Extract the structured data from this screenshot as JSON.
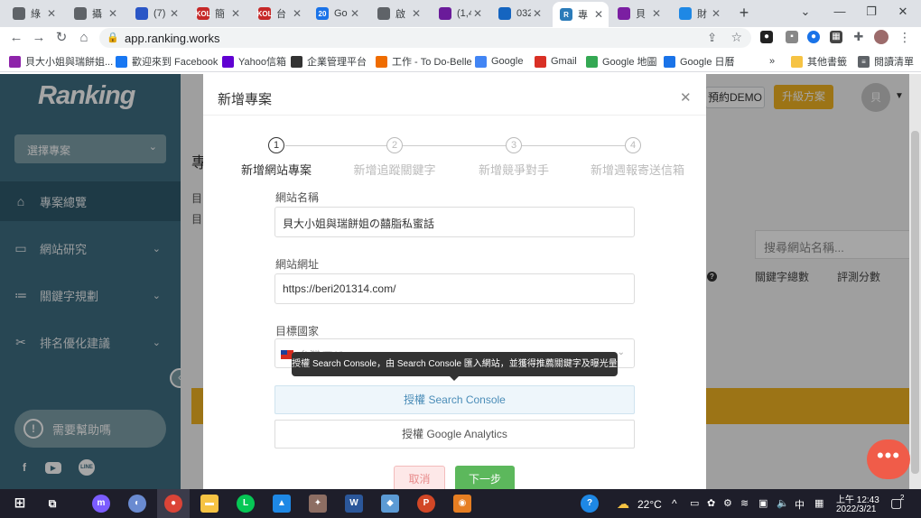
{
  "browser": {
    "tabs": [
      {
        "title": "綠",
        "icon": "globe-icon",
        "color": "#5f6368"
      },
      {
        "title": "攝",
        "icon": "globe-icon",
        "color": "#5f6368"
      },
      {
        "title": "(7)",
        "icon": "chat-icon",
        "color": "#2a56c6"
      },
      {
        "title": "簡",
        "icon": "kol-icon",
        "color": "#c62828",
        "badge": "KOL"
      },
      {
        "title": "台",
        "icon": "kol-icon",
        "color": "#c62828",
        "badge": "KOL"
      },
      {
        "title": "Go",
        "icon": "calendar-icon",
        "color": "#1a73e8",
        "badge": "20"
      },
      {
        "title": "啟",
        "icon": "globe-icon",
        "color": "#5f6368"
      },
      {
        "title": "(1,4",
        "icon": "mail-icon",
        "color": "#6a1b9a"
      },
      {
        "title": "032",
        "icon": "check-icon",
        "color": "#1565c0"
      },
      {
        "title": "專",
        "icon": "ranking-icon",
        "color": "#2b7bb9",
        "badge": "R"
      },
      {
        "title": "貝",
        "icon": "photo-icon",
        "color": "#7b1fa2"
      },
      {
        "title": "財",
        "icon": "edge-icon",
        "color": "#1e88e5"
      }
    ],
    "url": "app.ranking.works",
    "bookmarks": [
      {
        "label": "貝大小姐與瑞餅姐...",
        "icon": "photo-icon",
        "color": "#8e24aa"
      },
      {
        "label": "歡迎來到 Facebook",
        "icon": "facebook-icon",
        "color": "#1877f2"
      },
      {
        "label": "Yahoo信箱",
        "icon": "yahoo-icon",
        "color": "#6001d2"
      },
      {
        "label": "企業管理平台",
        "icon": "admin-icon",
        "color": "#333333"
      },
      {
        "label": "工作 - To Do-Belle",
        "icon": "todo-icon",
        "color": "#ef6c00"
      },
      {
        "label": "Google",
        "icon": "google-icon",
        "color": "#4285f4"
      },
      {
        "label": "Gmail",
        "icon": "gmail-icon",
        "color": "#d93025"
      },
      {
        "label": "Google 地圖",
        "icon": "maps-icon",
        "color": "#34a853"
      },
      {
        "label": "Google 日曆",
        "icon": "calendar-icon",
        "color": "#1a73e8"
      }
    ],
    "other_bookmarks": "其他書籤",
    "reading_list": "閱讀清單"
  },
  "app": {
    "logo": "Ranking",
    "project_select_placeholder": "選擇專案",
    "nav": [
      {
        "label": "專案總覽",
        "icon": "home-icon"
      },
      {
        "label": "網站研究",
        "icon": "monitor-icon"
      },
      {
        "label": "關鍵字規劃",
        "icon": "keyword-icon"
      },
      {
        "label": "排名優化建議",
        "icon": "tools-icon"
      }
    ],
    "help_label": "需要幫助嗎",
    "demo_button": "預約DEMO",
    "upgrade_button": "升級方案",
    "avatar_initial": "貝",
    "page_heading": "專",
    "page_text_1": "目",
    "page_text_2": "目",
    "search_site_placeholder": "搜尋網站名稱...",
    "col_keywords": "關鍵字總數",
    "col_score": "評測分數"
  },
  "modal": {
    "title": "新增專案",
    "steps": [
      {
        "num": "1",
        "label": "新增網站專案"
      },
      {
        "num": "2",
        "label": "新增追蹤關鍵字"
      },
      {
        "num": "3",
        "label": "新增競爭對手"
      },
      {
        "num": "4",
        "label": "新增週報寄送信箱"
      }
    ],
    "site_name_label": "網站名稱",
    "site_name_value": "貝大小姐與瑞餅姐の囍脂私蜜話",
    "site_url_label": "網站網址",
    "site_url_value": "https://beri201314.com/",
    "country_label": "目標國家",
    "country_value": "台灣(TW)",
    "tooltip": "授權 Search Console，由 Search Console 匯入網站，並獲得推薦關鍵字及曝光量",
    "auth_search_console": "授權 Search Console",
    "auth_google_analytics": "授權 Google Analytics",
    "cancel": "取消",
    "next": "下一步"
  },
  "taskbar": {
    "weather": "22°C",
    "time": "上午 12:43",
    "date": "2022/3/21",
    "notifications": "2"
  }
}
